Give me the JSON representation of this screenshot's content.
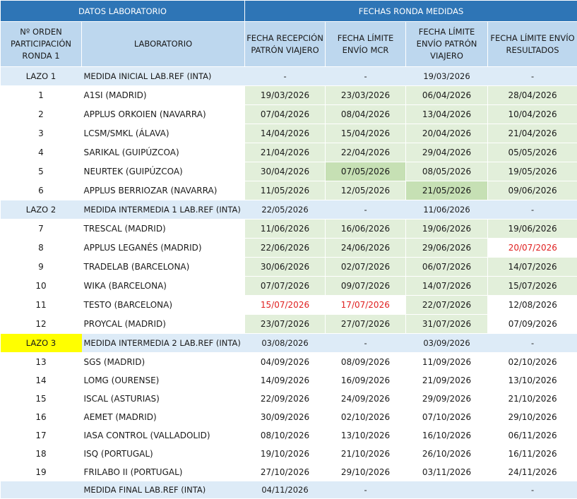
{
  "header": {
    "group_lab": "DATOS LABORATORIO",
    "group_dates": "FECHAS RONDA MEDIDAS",
    "col_order": "Nº ORDEN PARTICIPACIÓN RONDA 1",
    "col_lab": "LABORATORIO",
    "col_reception": "FECHA RECEPCIÓN PATRÓN VIAJERO",
    "col_mcr": "FECHA LÍMITE ENVÍO MCR",
    "col_ship": "FECHA LÍMITE ENVÍO PATRÓN VIAJERO",
    "col_results": "FECHA LÍMITE ENVÍO RESULTADOS"
  },
  "colors": {
    "header_dark": "#2e75b6",
    "header_light": "#bdd7ee",
    "loop_row": "#ddebf7",
    "green_light": "#e2efda",
    "green_dark": "#c6e0b4",
    "highlight_yellow": "#ffff00",
    "red_text": "#e02020"
  },
  "rows": [
    {
      "id": "LAZO 1",
      "lab": "MEDIDA INICIAL LAB.REF (INTA)",
      "reception": "-",
      "mcr": "-",
      "ship": "19/03/2026",
      "results": "-"
    },
    {
      "id": "1",
      "lab": "A1SI (MADRID)",
      "reception": "19/03/2026",
      "mcr": "23/03/2026",
      "ship": "06/04/2026",
      "results": "28/04/2026"
    },
    {
      "id": "2",
      "lab": "APPLUS ORKOIEN (NAVARRA)",
      "reception": "07/04/2026",
      "mcr": "08/04/2026",
      "ship": "13/04/2026",
      "results": "10/04/2026"
    },
    {
      "id": "3",
      "lab": "LCSM/SMKL (ÁLAVA)",
      "reception": "14/04/2026",
      "mcr": "15/04/2026",
      "ship": "20/04/2026",
      "results": "21/04/2026"
    },
    {
      "id": "4",
      "lab": "SARIKAL (GUIPÚZCOA)",
      "reception": "21/04/2026",
      "mcr": "22/04/2026",
      "ship": "29/04/2026",
      "results": "05/05/2026"
    },
    {
      "id": "5",
      "lab": "NEURTEK (GUIPÚZCOA)",
      "reception": "30/04/2026",
      "mcr": "07/05/2026",
      "ship": "08/05/2026",
      "results": "19/05/2026"
    },
    {
      "id": "6",
      "lab": "APPLUS BERRIOZAR (NAVARRA)",
      "reception": "11/05/2026",
      "mcr": "12/05/2026",
      "ship": "21/05/2026",
      "results": "09/06/2026"
    },
    {
      "id": "LAZO 2",
      "lab": "MEDIDA INTERMEDIA 1 LAB.REF (INTA)",
      "reception": "22/05/2026",
      "mcr": "-",
      "ship": "11/06/2026",
      "results": "-"
    },
    {
      "id": "7",
      "lab": "TRESCAL (MADRID)",
      "reception": "11/06/2026",
      "mcr": "16/06/2026",
      "ship": "19/06/2026",
      "results": "19/06/2026"
    },
    {
      "id": "8",
      "lab": "APPLUS LEGANÉS (MADRID)",
      "reception": "22/06/2026",
      "mcr": "24/06/2026",
      "ship": "29/06/2026",
      "results": "20/07/2026"
    },
    {
      "id": "9",
      "lab": "TRADELAB (BARCELONA)",
      "reception": "30/06/2026",
      "mcr": "02/07/2026",
      "ship": "06/07/2026",
      "results": "14/07/2026"
    },
    {
      "id": "10",
      "lab": "WIKA (BARCELONA)",
      "reception": "07/07/2026",
      "mcr": "09/07/2026",
      "ship": "14/07/2026",
      "results": "15/07/2026"
    },
    {
      "id": "11",
      "lab": "TESTO (BARCELONA)",
      "reception": "15/07/2026",
      "mcr": "17/07/2026",
      "ship": "22/07/2026",
      "results": "12/08/2026"
    },
    {
      "id": "12",
      "lab": "PROYCAL (MADRID)",
      "reception": "23/07/2026",
      "mcr": "27/07/2026",
      "ship": "31/07/2026",
      "results": "07/09/2026"
    },
    {
      "id": "LAZO 3",
      "lab": "MEDIDA INTERMEDIA 2 LAB.REF (INTA)",
      "reception": "03/08/2026",
      "mcr": "-",
      "ship": "03/09/2026",
      "results": "-"
    },
    {
      "id": "13",
      "lab": "SGS (MADRID)",
      "reception": "04/09/2026",
      "mcr": "08/09/2026",
      "ship": "11/09/2026",
      "results": "02/10/2026"
    },
    {
      "id": "14",
      "lab": "LOMG (OURENSE)",
      "reception": "14/09/2026",
      "mcr": "16/09/2026",
      "ship": "21/09/2026",
      "results": "13/10/2026"
    },
    {
      "id": "15",
      "lab": "ISCAL (ASTURIAS)",
      "reception": "22/09/2026",
      "mcr": "24/09/2026",
      "ship": "29/09/2026",
      "results": "21/10/2026"
    },
    {
      "id": "16",
      "lab": "AEMET (MADRID)",
      "reception": "30/09/2026",
      "mcr": "02/10/2026",
      "ship": "07/10/2026",
      "results": "29/10/2026"
    },
    {
      "id": "17",
      "lab": "IASA CONTROL (VALLADOLID)",
      "reception": "08/10/2026",
      "mcr": "13/10/2026",
      "ship": "16/10/2026",
      "results": "06/11/2026"
    },
    {
      "id": "18",
      "lab": "ISQ (PORTUGAL)",
      "reception": "19/10/2026",
      "mcr": "21/10/2026",
      "ship": "26/10/2026",
      "results": "16/11/2026"
    },
    {
      "id": "19",
      "lab": "FRILABO II (PORTUGAL)",
      "reception": "27/10/2026",
      "mcr": "29/10/2026",
      "ship": "03/11/2026",
      "results": "24/11/2026"
    },
    {
      "id": "",
      "lab": "MEDIDA FINAL LAB.REF (INTA)",
      "reception": "04/11/2026",
      "mcr": "-",
      "ship": "",
      "results": "-"
    }
  ]
}
